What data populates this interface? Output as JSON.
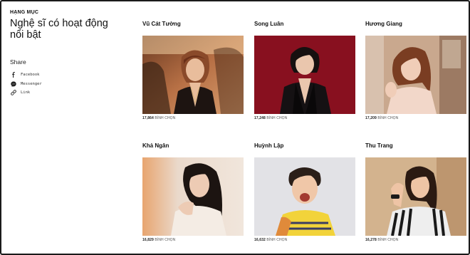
{
  "sidebar": {
    "eyebrow": "HẠNG MỤC",
    "title": "Nghệ sĩ có hoạt động nổi bật",
    "share_label": "Share",
    "share_items": [
      {
        "label": "Facebook",
        "icon": "facebook-icon"
      },
      {
        "label": "Messenger",
        "icon": "messenger-icon"
      },
      {
        "label": "Link",
        "icon": "link-icon"
      }
    ]
  },
  "artists": [
    {
      "name": "Vũ Cát Tường",
      "votes": "17,864",
      "vote_label": "BÌNH CHỌN",
      "palette": "#b86a4a"
    },
    {
      "name": "Song Luân",
      "votes": "17,248",
      "vote_label": "BÌNH CHỌN",
      "palette": "#8a1020"
    },
    {
      "name": "Hương Giang",
      "votes": "17,209",
      "vote_label": "BÌNH CHỌN",
      "palette": "#c9a88e"
    },
    {
      "name": "Khả Ngân",
      "votes": "16,829",
      "vote_label": "BÌNH CHỌN",
      "palette": "#e6d3c5"
    },
    {
      "name": "Huỳnh Lập",
      "votes": "16,632",
      "vote_label": "BÌNH CHỌN",
      "palette": "#dcdde2"
    },
    {
      "name": "Thu Trang",
      "votes": "16,278",
      "vote_label": "BÌNH CHỌN",
      "palette": "#d9b894"
    }
  ]
}
